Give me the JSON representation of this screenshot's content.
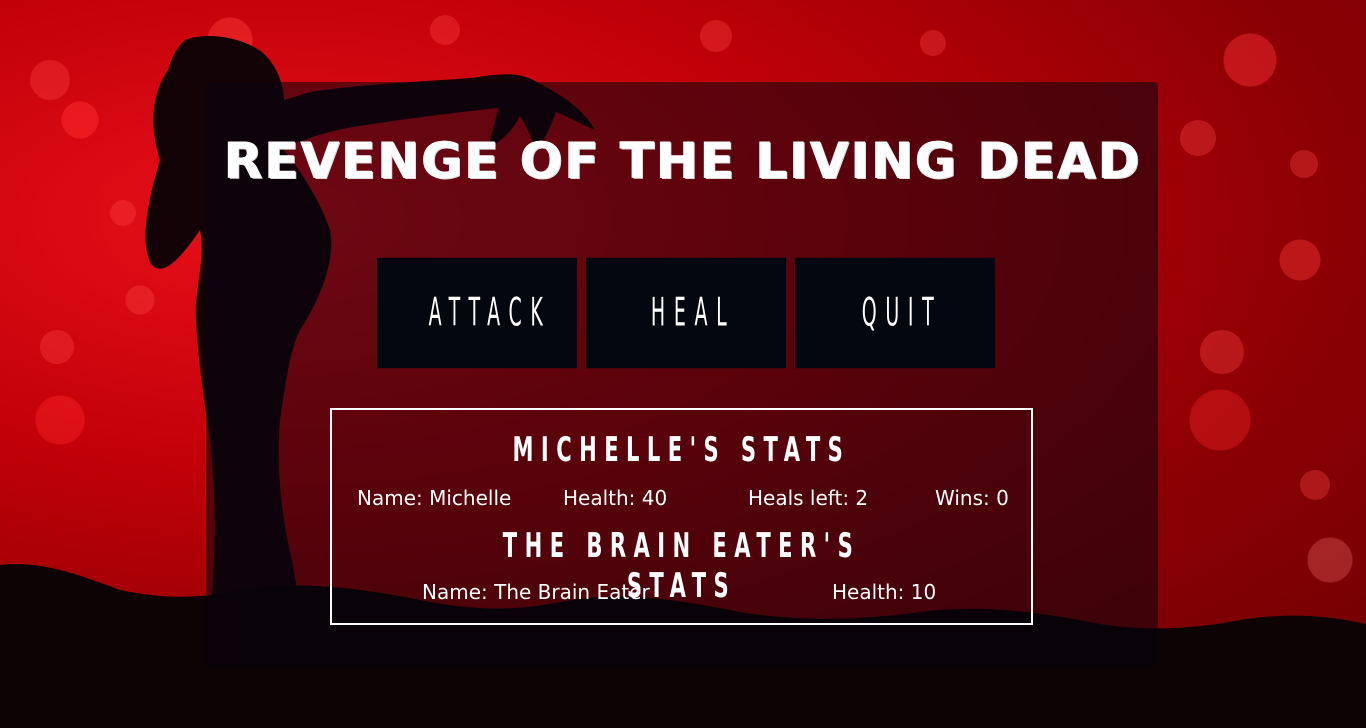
{
  "game": {
    "title": "Revenge of the Living Dead"
  },
  "actions": {
    "attack_label": "ATTACK",
    "heal_label": "HEAL",
    "quit_label": "QUIT"
  },
  "player": {
    "heading": "Michelle's Stats",
    "name": "Name: Michelle",
    "health": "Health: 40",
    "heals_left": "Heals left: 2",
    "wins": "Wins: 0"
  },
  "enemy": {
    "heading": "The Brain Eater's Stats",
    "name": "Name: The Brain Eater",
    "health": "Health: 10"
  },
  "colors": {
    "background": "#c10008",
    "panel": "#0a040e",
    "button": "#03070f",
    "text": "#ffffff"
  }
}
